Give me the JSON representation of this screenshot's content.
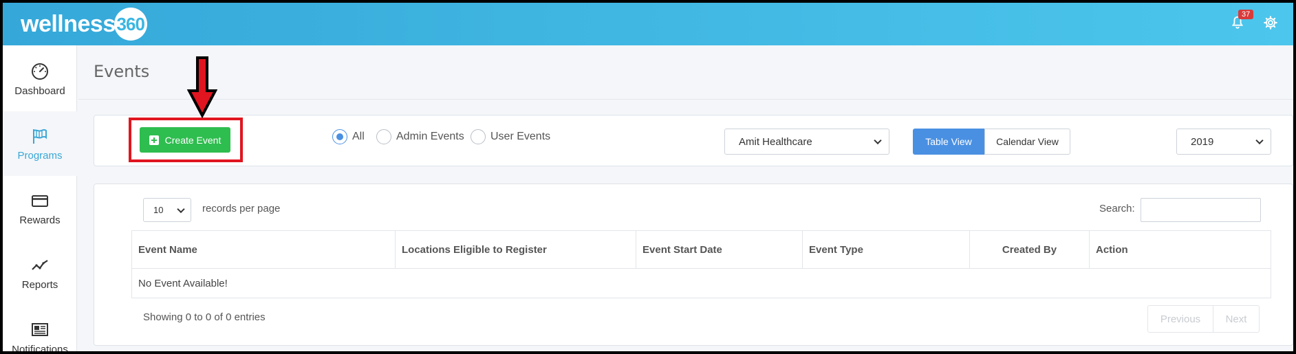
{
  "app": {
    "logo_text": "wellness",
    "logo_number": "360",
    "notification_count": "37"
  },
  "sidebar": {
    "items": [
      {
        "label": "Dashboard",
        "icon": "speedometer-icon"
      },
      {
        "label": "Programs",
        "icon": "flag-icon",
        "active": true
      },
      {
        "label": "Rewards",
        "icon": "credit-card-icon"
      },
      {
        "label": "Reports",
        "icon": "line-chart-icon"
      },
      {
        "label": "Notifications",
        "icon": "newspaper-icon"
      }
    ]
  },
  "page": {
    "title": "Events"
  },
  "toolbar": {
    "create_label": "Create Event",
    "filters": [
      {
        "label": "All",
        "checked": true
      },
      {
        "label": "Admin Events",
        "checked": false
      },
      {
        "label": "User Events",
        "checked": false
      }
    ],
    "organization_selected": "Amit Healthcare",
    "table_view_label": "Table View",
    "calendar_view_label": "Calendar View",
    "year_selected": "2019"
  },
  "table": {
    "records_per_page": "10",
    "records_per_page_label": "records per page",
    "search_label": "Search:",
    "search_value": "",
    "columns": [
      "Event Name",
      "Locations Eligible to Register",
      "Event Start Date",
      "Event Type",
      "Created By",
      "Action"
    ],
    "empty_message": "No Event Available!",
    "info": "Showing 0 to 0 of 0 entries",
    "previous_label": "Previous",
    "next_label": "Next"
  },
  "colors": {
    "header_start": "#35a8d9",
    "header_end": "#4cc6ec",
    "create_button": "#2ebd4f",
    "primary": "#4a90e2",
    "highlight_annotation": "#e0151f",
    "badge": "#d93b3b"
  }
}
